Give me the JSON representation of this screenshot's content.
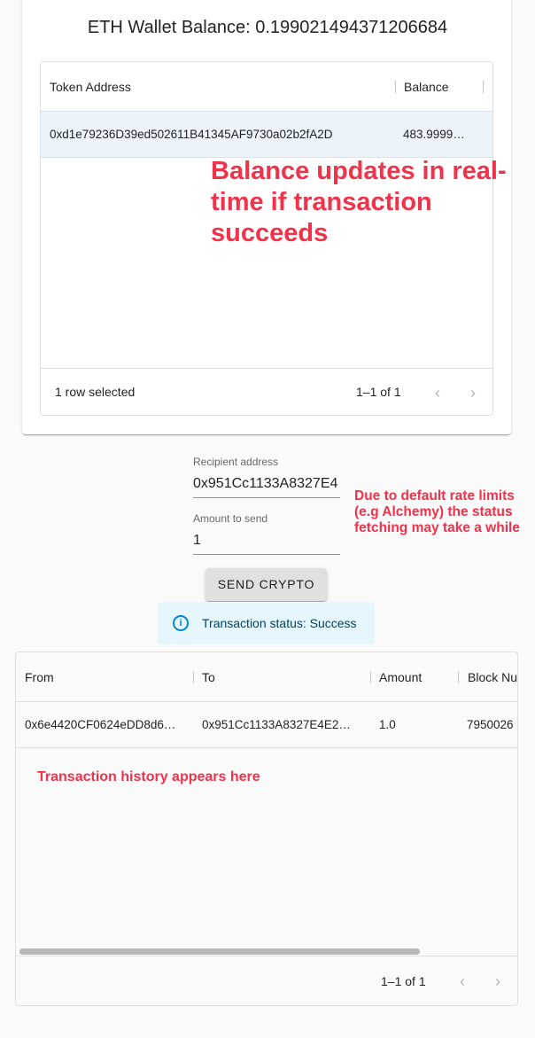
{
  "wallet": {
    "eth_balance_label": "ETH Wallet Balance: 0.199021494371206684"
  },
  "token_table": {
    "columns": [
      "Token Address",
      "Balance"
    ],
    "rows": [
      {
        "address": "0xd1e79236D39ed502611B41345AF9730a02b2fA2D",
        "balance": "483.9999…"
      }
    ],
    "footer_selected": "1 row selected",
    "footer_range": "1–1 of 1"
  },
  "annotations": {
    "balance_note": "Balance updates in real-time if transaction succeeds",
    "rate_limit_note": "Due to default rate limits (e.g Alchemy) the status fetching may take a while",
    "history_note": "Transaction history appears here"
  },
  "form": {
    "recipient_label": "Recipient address",
    "recipient_value": "0x951Cc1133A8327E4",
    "amount_label": "Amount to send",
    "amount_value": "1",
    "send_button": "SEND CRYPTO"
  },
  "status_alert": {
    "text": "Transaction status: Success",
    "icon": "info-icon"
  },
  "history_table": {
    "columns": [
      "From",
      "To",
      "Amount",
      "Block Nu"
    ],
    "rows": [
      {
        "from": "0x6e4420CF0624eDD8d6…",
        "to": "0x951Cc1133A8327E4E2…",
        "amount": "1.0",
        "block": "7950026"
      }
    ],
    "footer_range": "1–1 of 1"
  },
  "colors": {
    "annotation": "#f0334a",
    "selected_row": "#edf3fb",
    "alert_bg": "#e5f6fd",
    "alert_icon": "#0288d1"
  }
}
